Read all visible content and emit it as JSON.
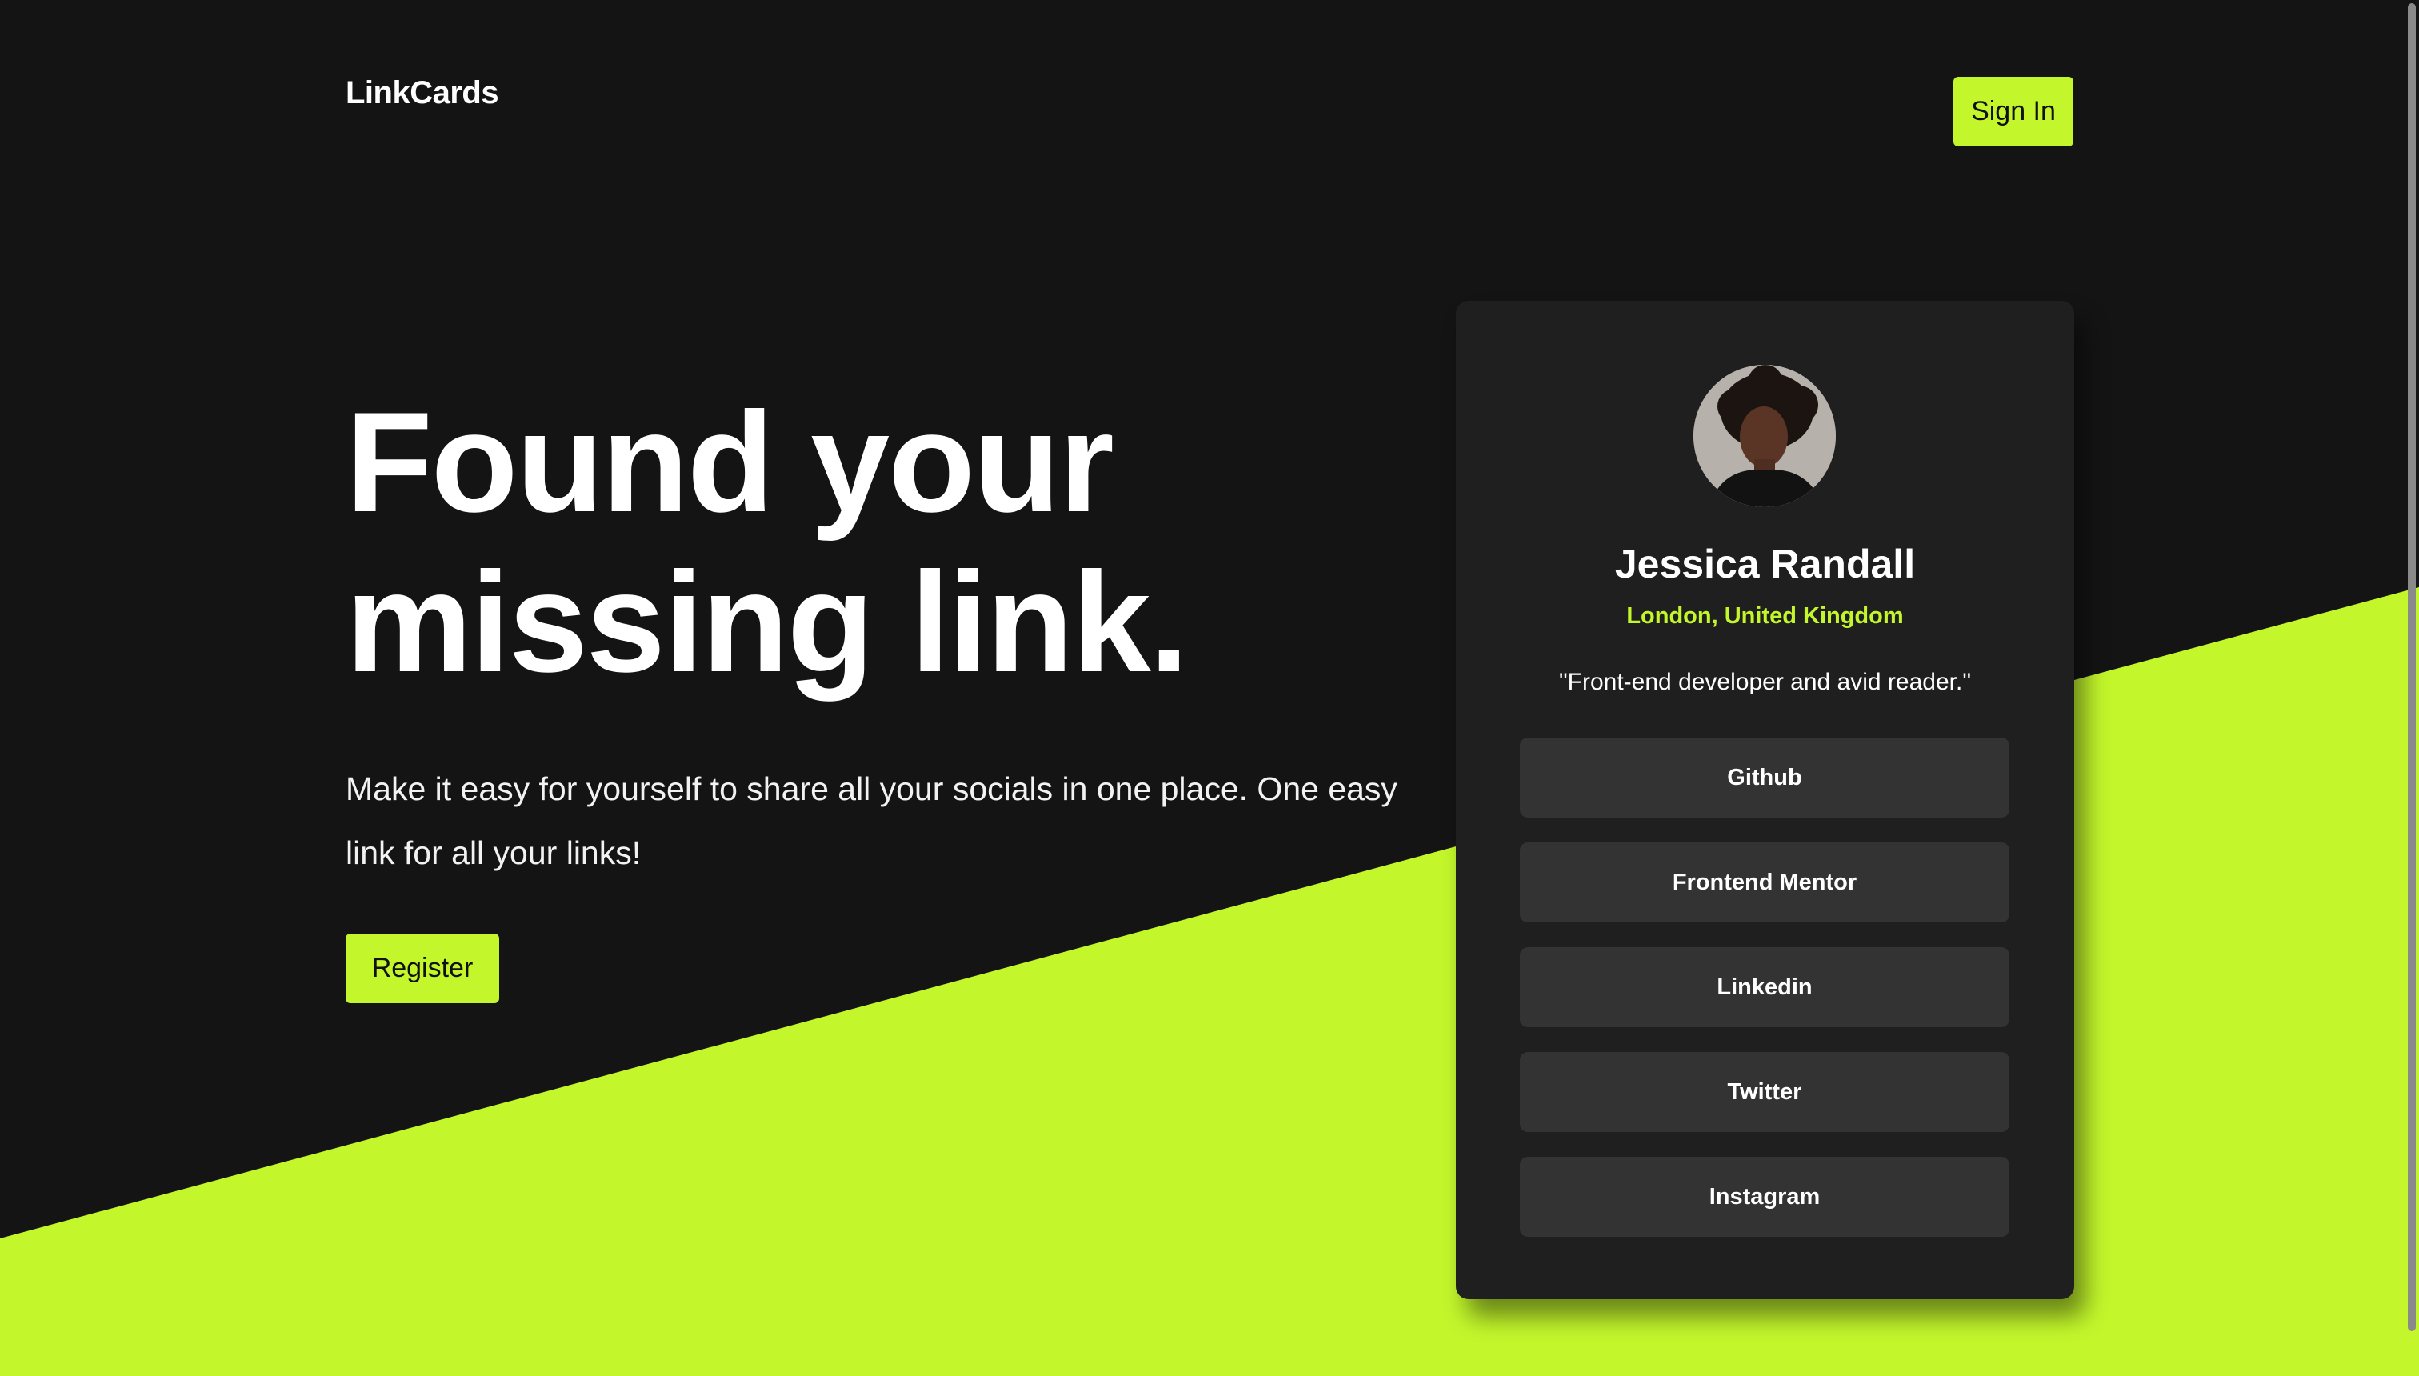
{
  "brand": {
    "name": "LinkCards"
  },
  "header": {
    "signin_label": "Sign In"
  },
  "hero": {
    "title_line1": "Found your",
    "title_line2": "missing link.",
    "description": "Make it easy for yourself to share all your socials in one place. One easy link for all your links!",
    "register_label": "Register"
  },
  "profile": {
    "name": "Jessica Randall",
    "location": "London, United Kingdom",
    "bio": "\"Front-end developer and avid reader.\"",
    "links": [
      {
        "label": "Github"
      },
      {
        "label": "Frontend Mentor"
      },
      {
        "label": "Linkedin"
      },
      {
        "label": "Twitter"
      },
      {
        "label": "Instagram"
      }
    ]
  },
  "colors": {
    "background": "#141414",
    "accent": "#c3f72b",
    "card": "#1f1f1f",
    "link_button": "#333333"
  }
}
